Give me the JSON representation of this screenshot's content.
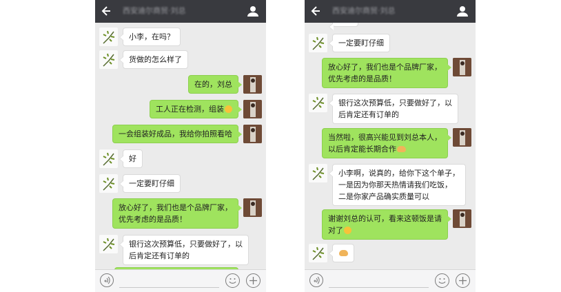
{
  "colors": {
    "topbar": "#393a3f",
    "chat_background": "#ebebeb",
    "outgoing_bubble": "#9fe35e",
    "incoming_bubble": "#ffffff"
  },
  "screens": [
    {
      "header": {
        "title": "西安迪尔商贸·刘总"
      },
      "messages": [
        {
          "from": "in",
          "text": "小李，在吗？"
        },
        {
          "from": "in",
          "text": "货做的怎么样了"
        },
        {
          "from": "out",
          "text": "在的，刘总"
        },
        {
          "from": "out",
          "text": "工人正在检测，组装"
        },
        {
          "from": "out",
          "text": "一会组装好成品，我给你拍照看哈"
        },
        {
          "from": "in",
          "text": "好"
        },
        {
          "from": "in",
          "text": "一定要盯仔细"
        },
        {
          "from": "out",
          "line1": "放心好了，我们也是个品牌厂家，",
          "line2": "优先考虑的是品质！"
        },
        {
          "from": "in",
          "line1": "银行这次预算低，只要做好了，以",
          "line2": "后肯定还有订单的"
        }
      ]
    },
    {
      "header": {
        "title": "西安迪尔商贸·刘总"
      },
      "messages": [
        {
          "from": "in",
          "text": "一定要盯仔细"
        },
        {
          "from": "out",
          "line1": "放心好了，我们也是个品牌厂家，",
          "line2": "优先考虑的是品质！"
        },
        {
          "from": "in",
          "line1": "银行这次预算低，只要做好了，以",
          "line2": "后肯定还有订单的"
        },
        {
          "from": "out",
          "line1": "当然啦，很高兴能见到刘总本人，",
          "line2": "以后肯定能长期合作"
        },
        {
          "from": "in",
          "line1": "小李啊，说真的，给你下这个单子，",
          "line2": "一是因为你那天热情请我们吃饭，",
          "line3": "二是你家产品确实质量可以"
        },
        {
          "from": "out",
          "line1": "谢谢刘总的认可，看来这顿饭是请",
          "line2": "对了"
        },
        {
          "from": "in",
          "text": ""
        }
      ]
    }
  ]
}
